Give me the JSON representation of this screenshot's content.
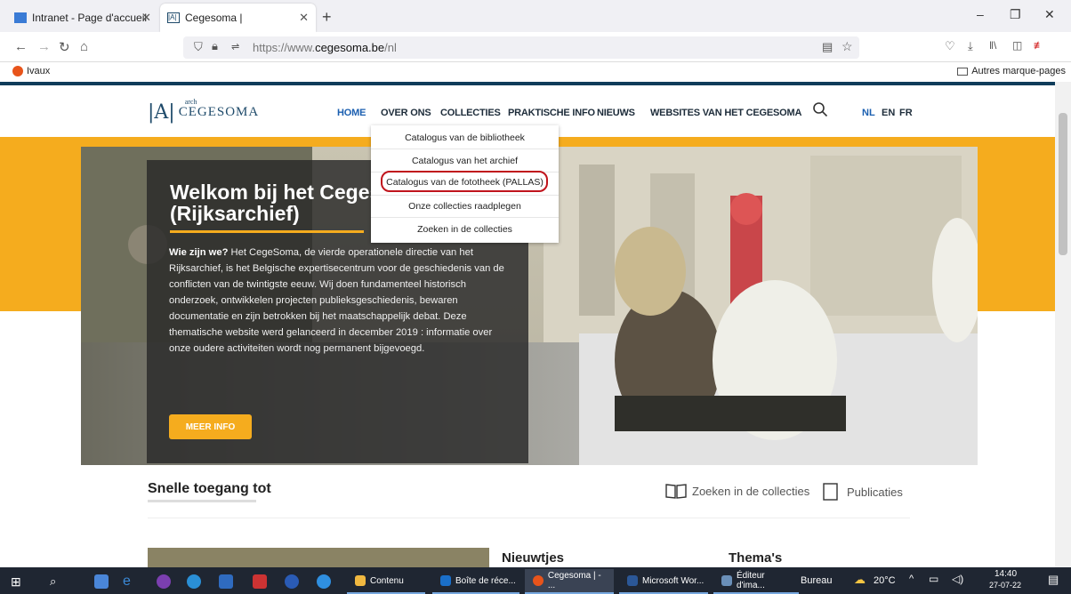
{
  "browser": {
    "tabs": [
      {
        "title": "Intranet - Page d'accueil"
      },
      {
        "title": "Cegesoma |"
      }
    ],
    "new_tab": "+",
    "url_prefix": "https://www.",
    "url_domain": "cegesoma.be",
    "url_path": "/nl",
    "bookmark_left": "Ivaux",
    "bookmark_right": "Autres marque-pages",
    "window_controls": [
      "–",
      "❐",
      "✕"
    ]
  },
  "site": {
    "logo_arch": "arch",
    "logo_text": "CEGESOMA",
    "menu": [
      {
        "label": "HOME",
        "active": true
      },
      {
        "label": "OVER ONS"
      },
      {
        "label": "COLLECTIES"
      },
      {
        "label": "PRAKTISCHE INFO"
      },
      {
        "label": "NIEUWS"
      },
      {
        "label": "WEBSITES VAN HET CEGESOMA"
      }
    ],
    "languages": [
      {
        "label": "NL",
        "active": true
      },
      {
        "label": "EN"
      },
      {
        "label": "FR"
      }
    ],
    "dropdown": [
      "Catalogus van de bibliotheek",
      "Catalogus van het archief",
      "Catalogus van de fototheek (PALLAS)",
      "Onze collecties raadplegen",
      "Zoeken in de collecties"
    ],
    "hero": {
      "title": "Welkom bij het Cegesoma\n(Rijksarchief)",
      "text_bold": "Wie zijn we?",
      "text": " Het CegeSoma, de vierde operationele directie van het Rijksarchief, is het Belgische expertisecentrum voor de geschiedenis van de conflicten van de twintigste eeuw. Wij doen fundamenteel historisch onderzoek, ontwikkelen projecten publieksgeschiedenis, bewaren documentatie en zijn betrokken bij het maatschappelijk debat. Deze thematische website werd gelanceerd in december 2019 : informatie over onze oudere activiteiten wordt nog permanent bijgevoegd.",
      "button": "MEER INFO"
    },
    "quick_access": "Snelle toegang tot",
    "quick_links": [
      "Zoeken in de collecties",
      "Publicaties"
    ],
    "sections": [
      "Nieuwtjes",
      "Thema's"
    ]
  },
  "taskbar": {
    "apps": [
      {
        "label": "Contenu"
      },
      {
        "label": "Boîte de réce..."
      },
      {
        "label": "Cegesoma | - ..."
      },
      {
        "label": "Microsoft Wor..."
      },
      {
        "label": "Éditeur d'ima..."
      }
    ],
    "bureau": "Bureau",
    "temperature": "20°C",
    "time": "14:40",
    "date": "27-07-22"
  },
  "colors": {
    "accent": "#f5ac1e",
    "brand": "#1e4a6a",
    "highlight": "#c0141c",
    "active_menu": "#1b5fb0"
  }
}
